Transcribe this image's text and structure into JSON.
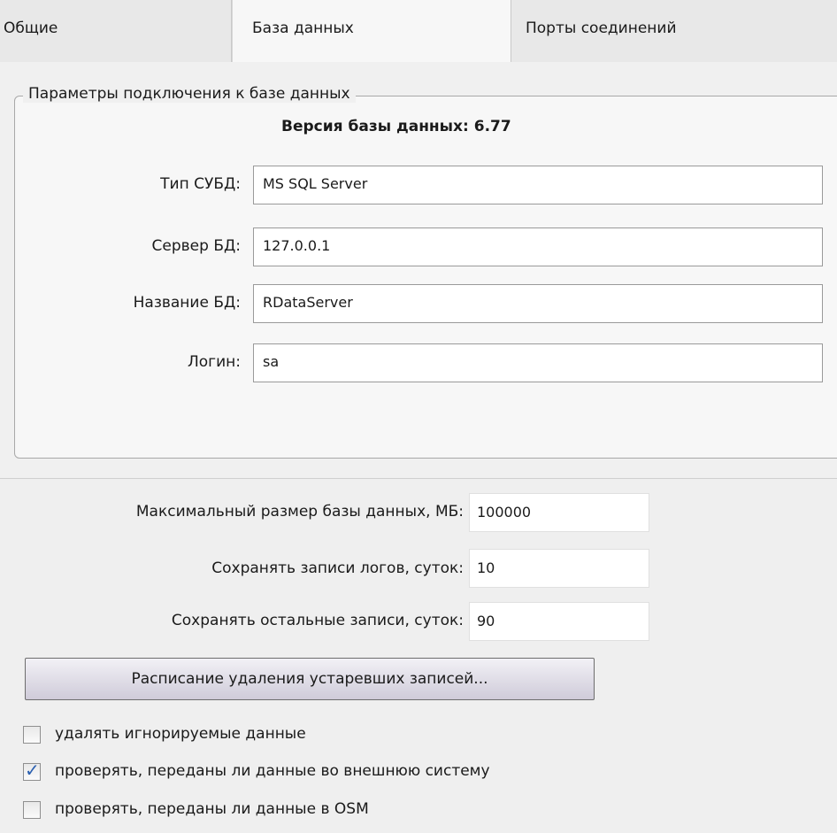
{
  "tabs": [
    {
      "label": "Общие"
    },
    {
      "label": "База данных"
    },
    {
      "label": "Порты соединений"
    }
  ],
  "connection": {
    "group_title": "Параметры подключения к базе данных",
    "version": "Версия базы данных: 6.77",
    "fields": [
      {
        "label": "Тип СУБД:",
        "value": "MS SQL Server"
      },
      {
        "label": "Сервер БД:",
        "value": "127.0.0.1"
      },
      {
        "label": "Название БД:",
        "value": "RDataServer"
      },
      {
        "label": "Логин:",
        "value": "sa"
      }
    ]
  },
  "storage": {
    "fields": [
      {
        "label": "Максимальный размер базы данных, МБ:",
        "value": "100000"
      },
      {
        "label": "Сохранять записи логов, суток:",
        "value": "10"
      },
      {
        "label": "Сохранять остальные записи, суток:",
        "value": "90"
      }
    ],
    "schedule_button": "Расписание удаления устаревших записей...",
    "checkboxes": [
      {
        "label": "удалять игнорируемые данные",
        "checked": false
      },
      {
        "label": "проверять, переданы ли данные во внешнюю систему",
        "checked": true
      },
      {
        "label": "проверять, переданы ли данные в OSM",
        "checked": false
      }
    ]
  }
}
